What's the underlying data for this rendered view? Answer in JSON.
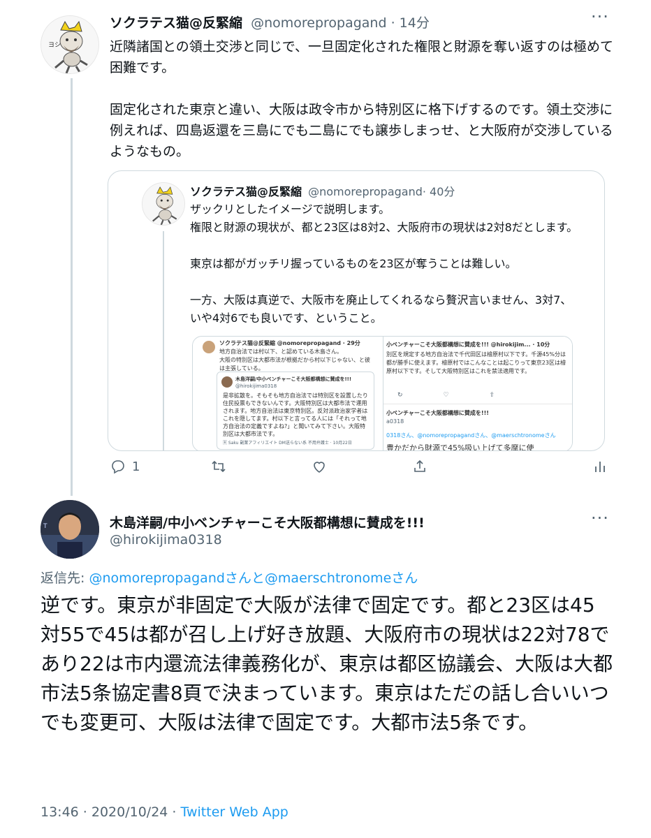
{
  "tweet1": {
    "name": "ソクラテス猫@反緊縮",
    "handle": "@nomorepropagand",
    "time": "· 14分",
    "body": "近隣諸国との領土交渉と同じで、一旦固定化された権限と財源を奪い返すのは極めて困難です。\n\n固定化された東京と違い、大阪は政令市から特別区に格下げするのです。領土交渉に例えれば、四島返還を三島にでも二島にでも譲歩しまっせ、と大阪府が交渉しているようなもの。",
    "reply_count": "1",
    "quoted": {
      "name": "ソクラテス猫@反緊縮",
      "handle": "@nomorepropagand",
      "time": "· 40分",
      "body": "ザックリとしたイメージで説明します。\n権限と財源の現状が、都と23区は8対2、大阪府市の現状は2対8だとします。\n\n東京は都がガッチリ握っているものを23区が奪うことは難しい。\n\n一方、大阪は真逆で、大阪市を廃止してくれるなら贅沢言いません、3対7、いや4対6でも良いです、ということ。",
      "screenshot": {
        "left_header": "ソクラテス猫@反緊縮 @nomorepropagand · 29分",
        "left_line1": "地方自治法では村以下、と認めている木島さん。",
        "left_line2": "大阪の特別区は大都市法が根拠だから村以下じゃない、と彼は主張している。",
        "card_name": "木島洋嗣/中小ベンチャーこそ大阪都構想に賛成を!!!",
        "card_handle": "@hirokijima0318",
        "card_body": "是非拡散を。そもそも地方自治法では特別区を設置したり住民投票もできないんです。大阪特別区は大都市法で運用されます。地方自治法は東京特別区。反対派政治家学者はこれを隠してます。村以下と言ってる人には「それって地方自治法の定義ですよね?」と聞いてみて下さい。大阪特別区は大都市法です。",
        "card_footer": "🅁 Saku 副業アフィリエイト DM送らない系 不用弁護士 · 10月22日",
        "right_header": "小ベンチャーこそ大阪都構想に賛成を!!! @hirokijim... · 10分",
        "right_body": "別区を規定する地方自治法で千代田区は檜原村以下です。千源45%分は都が勝手に使えます。檜原村ではこんなことは起こりって東京23区は檜原村以下です。そして大阪特別区はこれを禁法適用です。",
        "right_header2": "小ベンチャーこそ大阪都構想に賛成を!!!",
        "right_handle2": "a0318",
        "right_reply": "0318さん、@nomorepropagandさん、@maerschtronomeさん",
        "right_cut": "豊かだから財源で45%吸い上げて多摩に使"
      }
    }
  },
  "tweet2": {
    "name": "木島洋嗣/中小ベンチャーこそ大阪都構想に賛成を!!!",
    "handle": "@hirokijima0318",
    "reply_prefix": "返信先: ",
    "reply_targets": "@nomorepropagandさんと@maerschtronomeさん",
    "body": "逆です。東京が非固定で大阪が法律で固定です。都と23区は45対55で45は都が召し上げ好き放題、大阪府市の現状は22対78であり22は市内還流法律義務化が、東京は都区協議会、大阪は大都市法5条協定書8頁で決まっています。東京はただの話し合いいつでも変更可、大阪は法律で固定です。大都市法5条です。",
    "timestamp": "13:46 · 2020/10/24 · ",
    "source": "Twitter Web App"
  },
  "icons": [
    "more-icon",
    "reply-icon",
    "retweet-icon",
    "like-icon",
    "share-icon",
    "analytics-icon"
  ],
  "colors": {
    "accent": "#1d9bf0",
    "secondary_text": "#536471",
    "border": "#cfd9de"
  }
}
